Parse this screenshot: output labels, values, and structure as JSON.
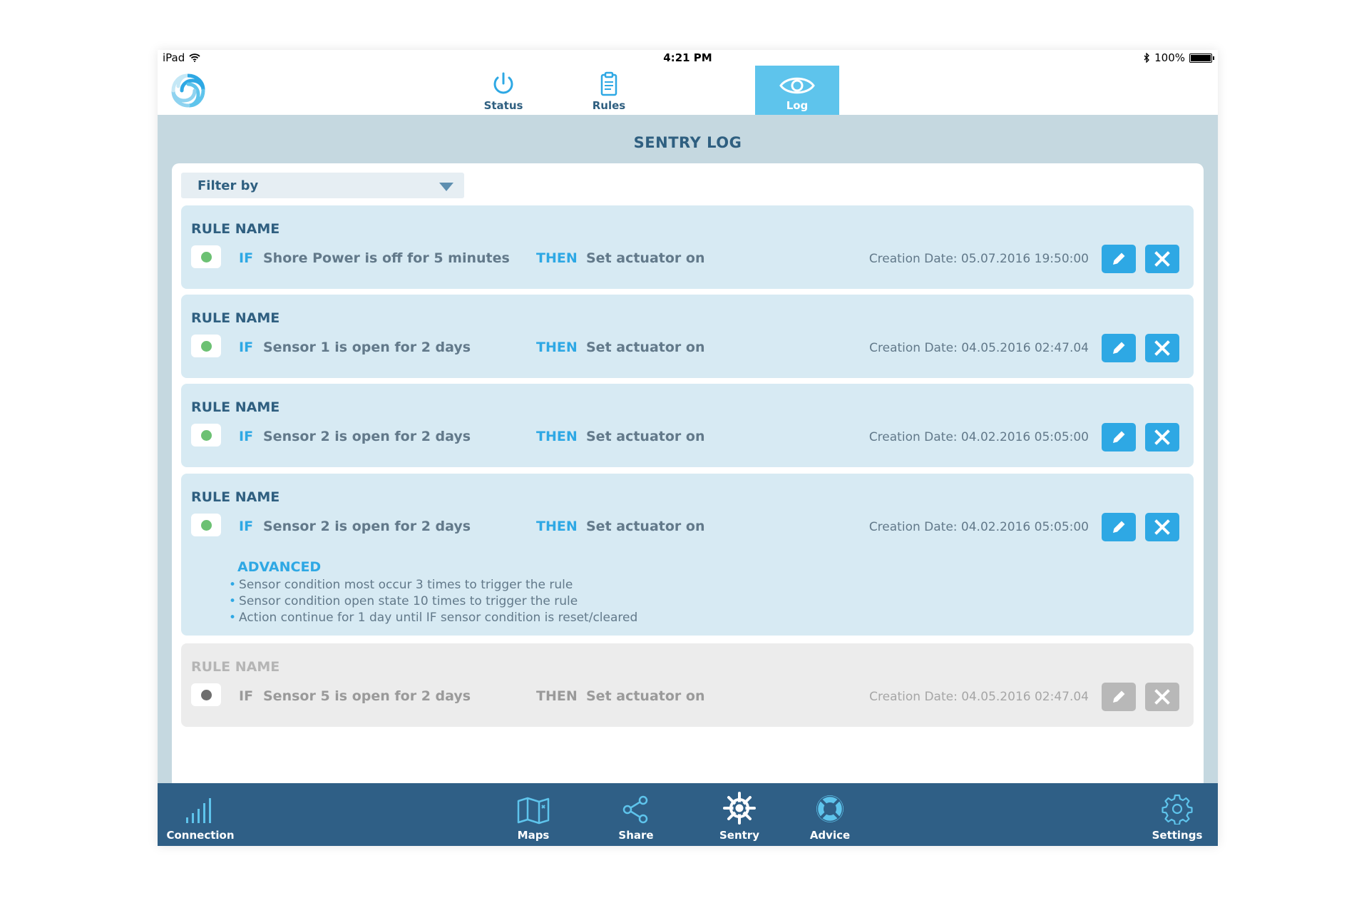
{
  "status_bar": {
    "device": "iPad",
    "time": "4:21 PM",
    "battery": "100%"
  },
  "top_tabs": [
    {
      "label": "Status",
      "icon": "power-icon",
      "active": false
    },
    {
      "label": "Rules",
      "icon": "clipboard-icon",
      "active": false
    },
    {
      "label": "Log",
      "icon": "eye-icon",
      "active": true
    }
  ],
  "page": {
    "title": "SENTRY LOG"
  },
  "filter": {
    "label": "Filter by"
  },
  "rules": [
    {
      "name": "RULE NAME",
      "if": "IF",
      "condition": "Shore Power is off for 5 minutes",
      "then": "THEN",
      "action": "Set actuator on",
      "date": "Creation Date: 05.07.2016 19:50:00",
      "enabled": true
    },
    {
      "name": "RULE NAME",
      "if": "IF",
      "condition": "Sensor 1 is open for 2 days",
      "then": "THEN",
      "action": "Set actuator on",
      "date": "Creation Date: 04.05.2016 02:47.04",
      "enabled": true
    },
    {
      "name": "RULE NAME",
      "if": "IF",
      "condition": "Sensor 2 is open for 2 days",
      "then": "THEN",
      "action": "Set actuator on",
      "date": "Creation Date: 04.02.2016 05:05:00",
      "enabled": true
    },
    {
      "name": "RULE NAME",
      "if": "IF",
      "condition": "Sensor 2 is open for 2 days",
      "then": "THEN",
      "action": "Set actuator on",
      "date": "Creation Date: 04.02.2016 05:05:00",
      "enabled": true,
      "advanced": {
        "title": "ADVANCED",
        "items": [
          "Sensor condition most occur 3 times to trigger the rule",
          "Sensor condition open state 10 times to trigger the rule",
          "Action continue for 1 day until IF sensor condition is reset/cleared"
        ]
      }
    },
    {
      "name": "RULE NAME",
      "if": "IF",
      "condition": "Sensor 5 is open for 2 days",
      "then": "THEN",
      "action": "Set actuator on",
      "date": "Creation Date: 04.05.2016 02:47.04",
      "enabled": false
    }
  ],
  "bottom_tabs": [
    {
      "label": "Connection",
      "icon": "signal-bars-icon"
    },
    {
      "label": "Maps",
      "icon": "map-icon"
    },
    {
      "label": "Share",
      "icon": "share-icon"
    },
    {
      "label": "Sentry",
      "icon": "ship-wheel-icon",
      "active": true
    },
    {
      "label": "Advice",
      "icon": "lifebuoy-icon"
    },
    {
      "label": "Settings",
      "icon": "gear-icon"
    }
  ],
  "colors": {
    "accent": "#2ea8e4",
    "navy": "#2f5f86",
    "active_tab": "#5ec4ec",
    "enabled_dot": "#6cc173"
  }
}
